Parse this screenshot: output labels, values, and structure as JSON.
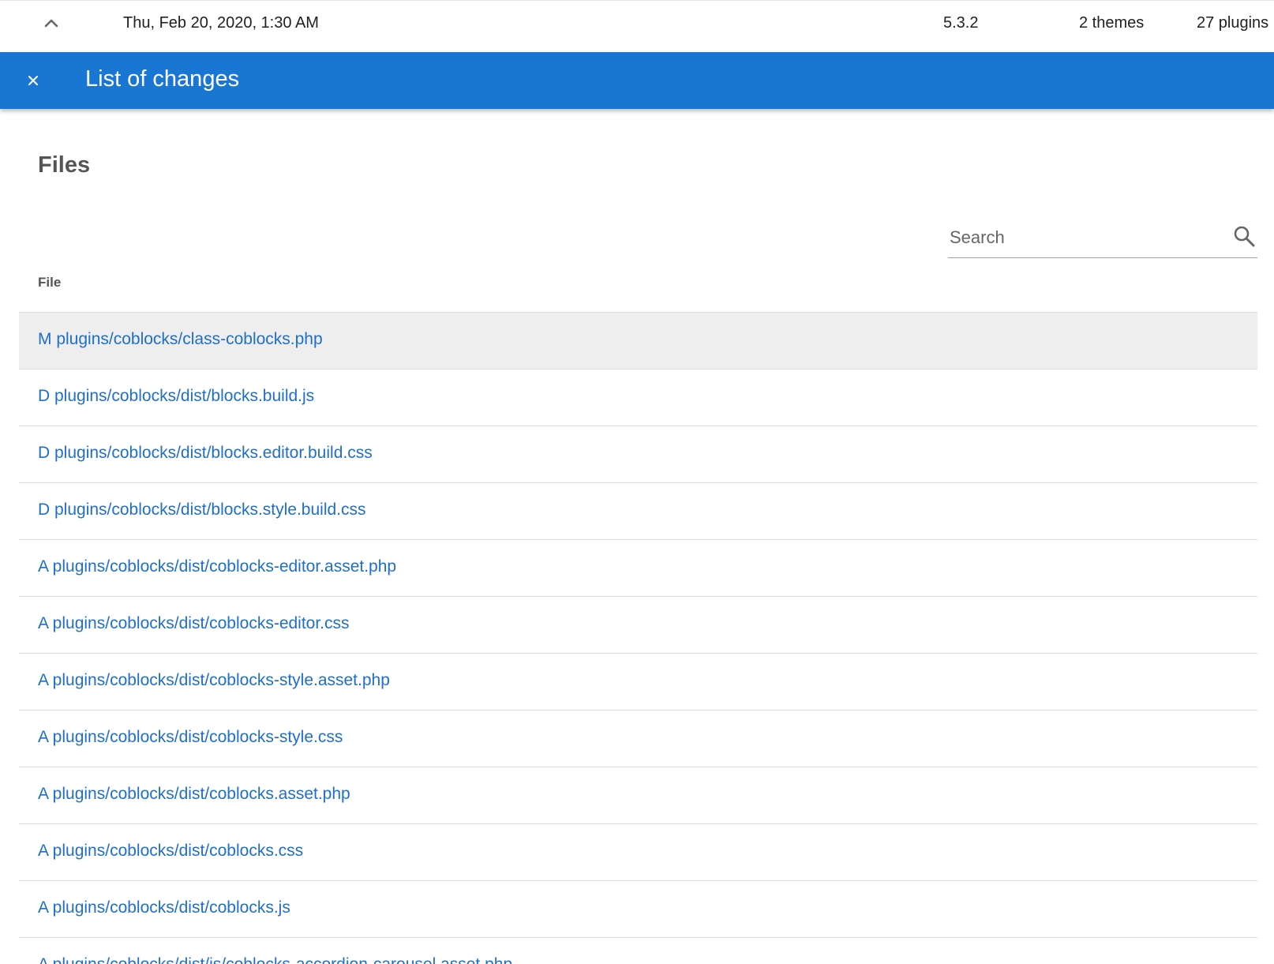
{
  "backup_row": {
    "date": "Thu, Feb 20, 2020, 1:30 AM",
    "version": "5.3.2",
    "themes": "2 themes",
    "plugins": "27 plugins"
  },
  "toolbar": {
    "title": "List of changes"
  },
  "section": {
    "title": "Files"
  },
  "search": {
    "placeholder": "Search",
    "value": ""
  },
  "table": {
    "column_header": "File",
    "rows": [
      "M plugins/coblocks/class-coblocks.php",
      "D plugins/coblocks/dist/blocks.build.js",
      "D plugins/coblocks/dist/blocks.editor.build.css",
      "D plugins/coblocks/dist/blocks.style.build.css",
      "A plugins/coblocks/dist/coblocks-editor.asset.php",
      "A plugins/coblocks/dist/coblocks-editor.css",
      "A plugins/coblocks/dist/coblocks-style.asset.php",
      "A plugins/coblocks/dist/coblocks-style.css",
      "A plugins/coblocks/dist/coblocks.asset.php",
      "A plugins/coblocks/dist/coblocks.css",
      "A plugins/coblocks/dist/coblocks.js",
      "A plugins/coblocks/dist/js/coblocks-accordion-carousel.asset.php"
    ]
  },
  "colors": {
    "accent": "#1976d2",
    "link": "#1e6fcc",
    "selected_row": "#eeeeee"
  },
  "icons": {
    "collapse": "chevron-up-icon",
    "close": "close-icon",
    "search": "search-icon"
  }
}
